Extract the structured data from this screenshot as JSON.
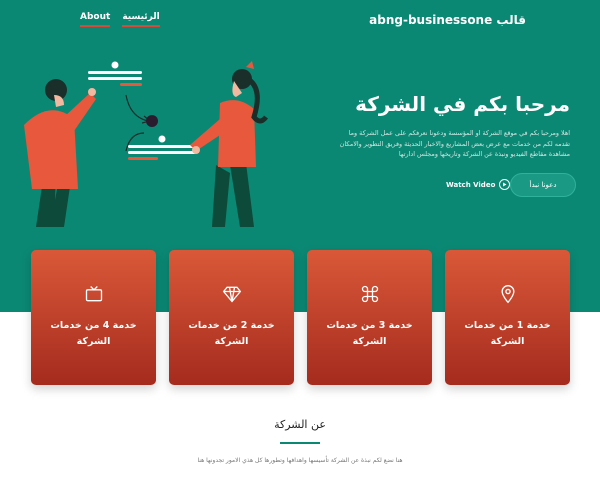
{
  "header": {
    "brand": "قالب abng-businessone",
    "nav": [
      {
        "label": "الرئيسية"
      },
      {
        "label": "About"
      }
    ]
  },
  "hero": {
    "title": "مرحبا بكم في الشركة",
    "description": "اهلا ومرحبا بكم في موقع الشركة او المؤسسة ودعونا نعرفكم على عمل الشركة وما تقدمه لكم من خدمات مع عرض بعض المشاريع والاخبار الحديثة وفريق التطوير والامكان مشاهدة مقاطع الفيديو ونبذة عن الشركة وتاريخها ومجلس ادارتها",
    "cta_label": "دعونا نبدأ",
    "watch_label": "Watch Video"
  },
  "services": [
    {
      "title": "خدمة 1 من خدمات الشركة",
      "icon": "map-pin-icon"
    },
    {
      "title": "خدمة 2 من خدمات الشركة",
      "icon": "diamond-icon"
    },
    {
      "title": "خدمة 3 من خدمات الشركة",
      "icon": "command-icon"
    },
    {
      "title": "خدمة 4 من خدمات الشركة",
      "icon": "tv-icon"
    }
  ],
  "about": {
    "title": "عن الشركة",
    "text": "هنا نضع لكم نبذة عن الشركة تأسيسها واهدافها وتطورها كل هذي الامور تجدونها هنا"
  },
  "colors": {
    "hero_bg": "#0b8874",
    "card_top": "#d95838",
    "card_bottom": "#a52b1e",
    "accent": "#d64a3a"
  }
}
